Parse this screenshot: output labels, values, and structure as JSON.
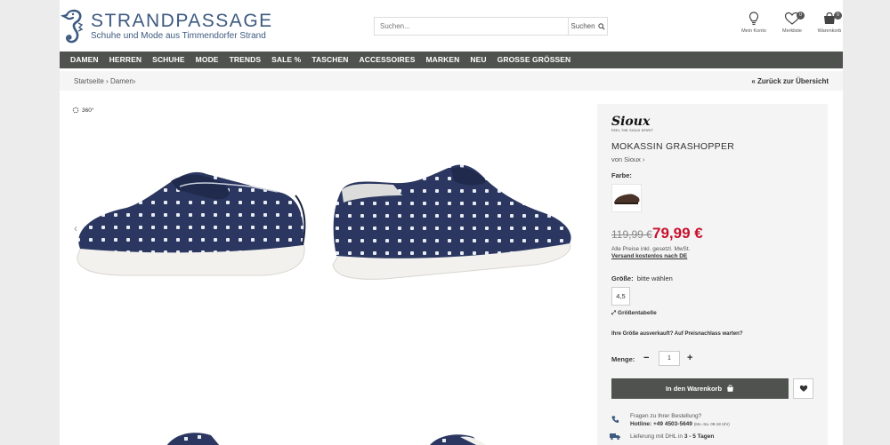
{
  "header": {
    "logo_title": "STRANDPASSAGE",
    "logo_subtitle": "Schuhe und Mode aus Timmendorfer Strand",
    "search_placeholder": "Suchen...",
    "search_button": "Suchen",
    "account_label": "Mein Konto",
    "wishlist_label": "Merkliste",
    "wishlist_count": "0",
    "cart_label": "Warenkorb",
    "cart_count": "0",
    "icons": [
      "lightbulb-icon",
      "heart-icon",
      "cart-icon",
      "search-icon"
    ]
  },
  "nav": {
    "items": [
      "DAMEN",
      "HERREN",
      "SCHUHE",
      "MODE",
      "TRENDS",
      "SALE %",
      "TASCHEN",
      "ACCESSOIRES",
      "MARKEN",
      "NEU",
      "GROSSE GRÖSSEN"
    ]
  },
  "breadcrumb": {
    "items": [
      "Startseite",
      "Damen"
    ],
    "separator": "›",
    "back_link": "« Zurück zur Übersicht"
  },
  "gallery": {
    "view_360": "360°",
    "prev_arrow": "‹"
  },
  "product": {
    "brand_logo": "Sioux",
    "brand_tagline": "FEEL THE SIOUX SPIRIT",
    "title": "MOKASSIN GRASHOPPER",
    "by_brand": "von Sioux ›",
    "color_label": "Farbe:",
    "old_price": "119,99 €",
    "new_price": "79,99 €",
    "tax_note": "Alle Preise inkl. gesetzl. MwSt.",
    "shipping_note": "Versand kostenlos nach DE",
    "size_label": "Größe:",
    "size_value": "bitte wählen",
    "sizes": [
      "4,5"
    ],
    "size_table": "Größentabelle",
    "sold_out_note": "Ihre Größe ausverkauft? Auf Preisnachlass warten?",
    "quantity_label": "Menge:",
    "quantity_minus": "−",
    "quantity_value": "1",
    "quantity_plus": "+",
    "add_to_cart": "In den Warenkorb",
    "question": "Fragen zu Ihrer Bestellung?",
    "hotline": "Hotline: +49 4503-5649",
    "hotline_hours": "(Mo.-Sa. 09-18 Uhr)",
    "delivery_prefix": "Lieferung mit DHL in",
    "delivery_days": "3 - 5 Tagen"
  },
  "colors": {
    "nav_bg": "#4f524f",
    "brand_blue": "#3d5a80",
    "sale_red": "#c8102e",
    "panel_bg": "#f4f4f4",
    "shoe_navy": "#2b3760"
  }
}
